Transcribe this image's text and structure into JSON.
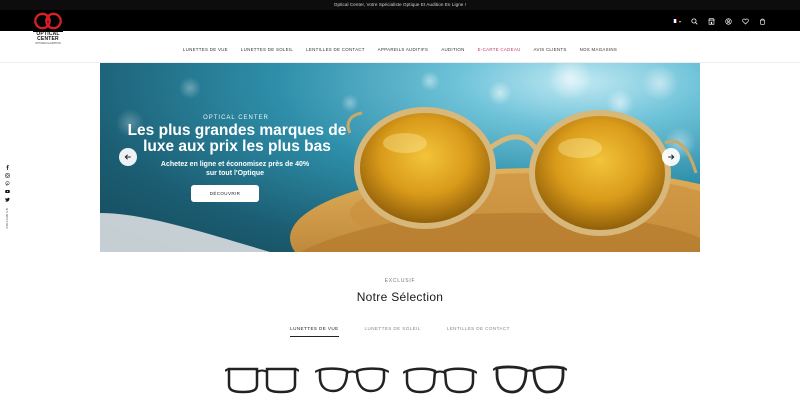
{
  "announcement": "Optical Center, Votre Spécialiste Optique Et Audition En Ligne !",
  "logo": {
    "name": "OPTICAL CENTER",
    "tagline": "OPTICIEN & AUDITION"
  },
  "header_icons": [
    "flag-fr-icon",
    "search-icon",
    "store-icon",
    "account-icon",
    "heart-icon",
    "cart-icon"
  ],
  "nav": {
    "items": [
      {
        "label": "LUNETTES DE VUE",
        "highlight": false
      },
      {
        "label": "LUNETTES DE SOLEIL",
        "highlight": false
      },
      {
        "label": "LENTILLES DE CONTACT",
        "highlight": false
      },
      {
        "label": "APPAREILS AUDITIFS",
        "highlight": false
      },
      {
        "label": "AUDITION",
        "highlight": false
      },
      {
        "label": "E-CARTE CADEAU",
        "highlight": true
      },
      {
        "label": "AVIS CLIENTS",
        "highlight": false
      },
      {
        "label": "NOS MAGASINS",
        "highlight": false
      }
    ]
  },
  "social": {
    "icons": [
      "facebook-icon",
      "instagram-icon",
      "pinterest-icon",
      "youtube-icon",
      "twitter-icon"
    ],
    "label": "FOLLOW US"
  },
  "hero": {
    "kicker": "OPTICAL CENTER",
    "title": "Les plus grandes marques de luxe aux prix les plus bas",
    "subtitle": "Achetez en ligne et économisez près de 40% sur tout l'Optique",
    "cta": "DÉCOUVRIR"
  },
  "selection": {
    "kicker": "EXCLUSIF",
    "title": "Notre Sélection",
    "tabs": [
      {
        "label": "LUNETTES DE VUE",
        "active": true
      },
      {
        "label": "LUNETTES DE SOLEIL",
        "active": false
      },
      {
        "label": "LENTILLES DE CONTACT",
        "active": false
      }
    ]
  },
  "colors": {
    "accent_pink": "#c4356f",
    "logo_red": "#d81f26",
    "header_bg": "#000000"
  }
}
